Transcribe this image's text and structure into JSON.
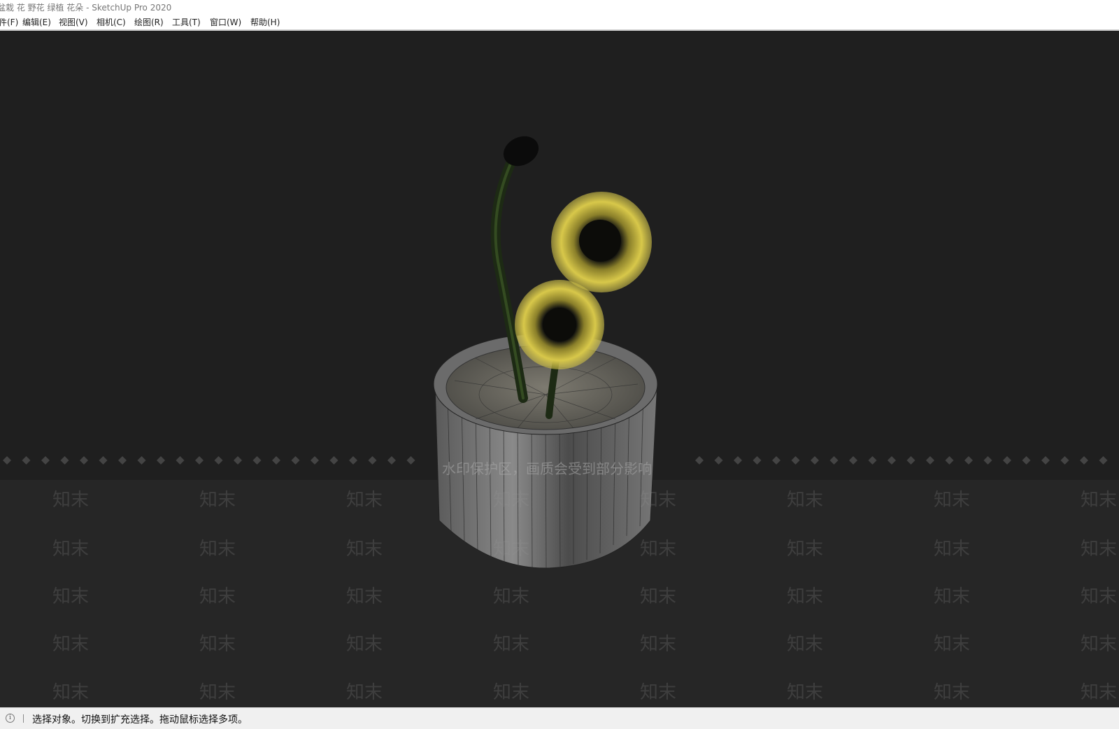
{
  "window": {
    "title": "盆栽 花 野花 绿植 花朵 - SketchUp Pro 2020"
  },
  "menu": {
    "items": [
      {
        "label": "文件(F)"
      },
      {
        "label": "编辑(E)"
      },
      {
        "label": "视图(V)"
      },
      {
        "label": "相机(C)"
      },
      {
        "label": "绘图(R)"
      },
      {
        "label": "工具(T)"
      },
      {
        "label": "窗口(W)"
      },
      {
        "label": "帮助(H)"
      }
    ]
  },
  "viewport": {
    "background": "#1f1f1f",
    "watermark_notice": "水印保护区，画质会受到部分影响",
    "watermark_text": "知末",
    "flower_color": "#d8c84a",
    "pot_color": "#6a6a6a"
  },
  "status": {
    "icon": "info-icon",
    "text": "选择对象。切换到扩充选择。拖动鼠标选择多项。"
  }
}
